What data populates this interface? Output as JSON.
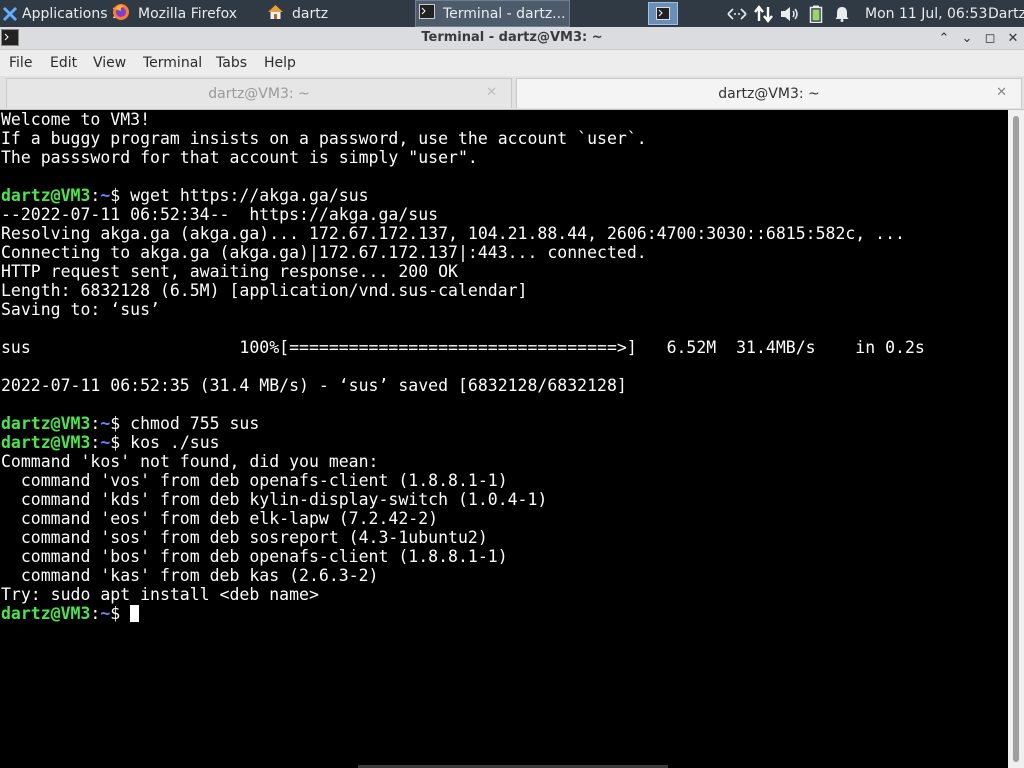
{
  "panel": {
    "apps_label": "Applications ☰",
    "firefox_label": "Mozilla Firefox",
    "files_label": "dartz",
    "terminal_label": "Terminal - dartz...",
    "clock": "Mon 11 Jul, 06:53",
    "user": "Dartz",
    "icons": [
      "xfce-icon",
      "firefox-icon",
      "home-folder-icon",
      "terminal-icon",
      "network-arrows-icon",
      "network-transfer-icon",
      "volume-icon",
      "battery-icon",
      "notifications-bell-icon"
    ]
  },
  "window": {
    "title": "Terminal - dartz@VM3: ~",
    "minimize": "⌃",
    "restore": "⌄",
    "maximize": "◻",
    "close": "✕"
  },
  "menu": [
    "File",
    "Edit",
    "View",
    "Terminal",
    "Tabs",
    "Help"
  ],
  "tabs": [
    {
      "label": "dartz@VM3: ~",
      "close": "✕"
    },
    {
      "label": "dartz@VM3: ~",
      "close": "✕"
    }
  ],
  "prompt": {
    "user_host": "dartz@VM3",
    "sep": ":",
    "path": "~",
    "sym": "$ "
  },
  "terminal": {
    "lines": [
      "Welcome to VM3!",
      "If a buggy program insists on a password, use the account `user`.",
      "The passsword for that account is simply \"user\".",
      "",
      "wget https://akga.ga/sus",
      "--2022-07-11 06:52:34--  https://akga.ga/sus",
      "Resolving akga.ga (akga.ga)... 172.67.172.137, 104.21.88.44, 2606:4700:3030::6815:582c, ...",
      "Connecting to akga.ga (akga.ga)|172.67.172.137|:443... connected.",
      "HTTP request sent, awaiting response... 200 OK",
      "Length: 6832128 (6.5M) [application/vnd.sus-calendar]",
      "Saving to: ‘sus’",
      "",
      "sus                     100%[=================================>]   6.52M  31.4MB/s    in 0.2s",
      "",
      "2022-07-11 06:52:35 (31.4 MB/s) - ‘sus’ saved [6832128/6832128]",
      "",
      "chmod 755 sus",
      "kos ./sus",
      "Command 'kos' not found, did you mean:",
      "  command 'vos' from deb openafs-client (1.8.8.1-1)",
      "  command 'kds' from deb kylin-display-switch (1.0.4-1)",
      "  command 'eos' from deb elk-lapw (7.2.42-2)",
      "  command 'sos' from deb sosreport (4.3-1ubuntu2)",
      "  command 'bos' from deb openafs-client (1.8.8.1-1)",
      "  command 'kas' from deb kas (2.6.3-2)",
      "Try: sudo apt install <deb name>",
      ""
    ],
    "prompt_line_indices": [
      4,
      16,
      17,
      26
    ]
  }
}
